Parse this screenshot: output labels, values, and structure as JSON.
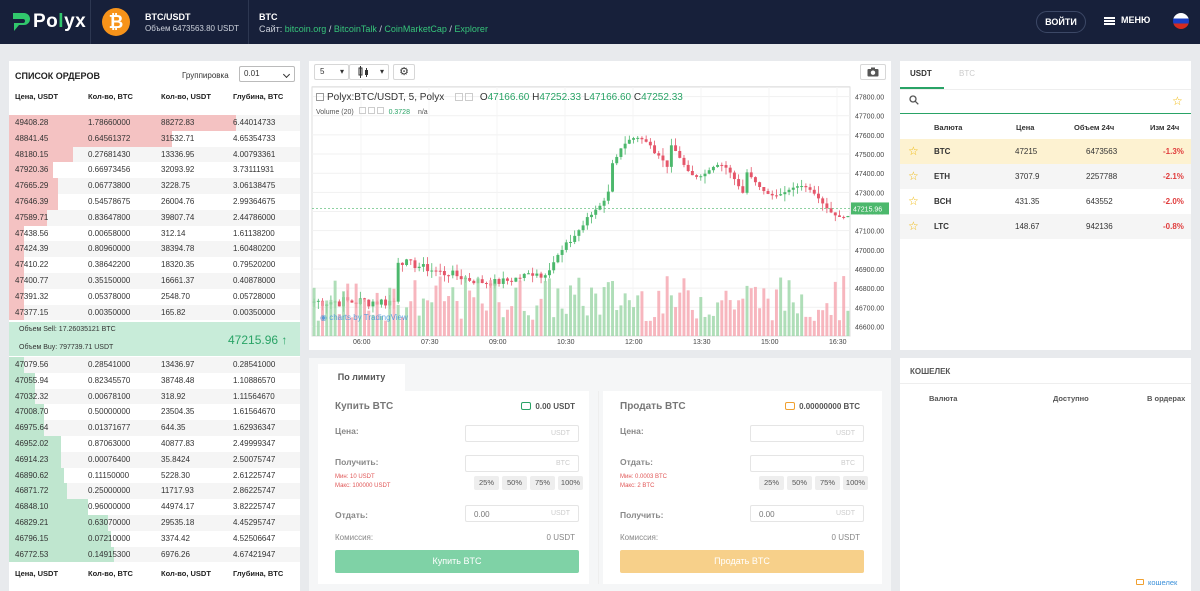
{
  "header": {
    "brand_prefix": "Po",
    "brand_mid": "l",
    "brand_suffix": "yx",
    "pair": "BTC/USDT",
    "volume": "Объем 6473563.80 USDT",
    "coin": "BTC",
    "sites_label": "Сайт:",
    "links": [
      "bitcoin.org",
      "BitcoinTalk",
      "CoinMarketCap",
      "Explorer"
    ],
    "login": "ВОЙТИ",
    "menu": "МЕНЮ"
  },
  "orderbook": {
    "title": "СПИСОК ОРДЕРОВ",
    "grouping_label": "Группировка",
    "grouping_value": "0.01",
    "headers": [
      "Цена, USDT",
      "Кол-во, BTC",
      "Кол-во, USDT",
      "Глубина, BTC"
    ],
    "asks": [
      [
        "49408.28",
        "1.78660000",
        "88272.83",
        "6.44014733",
        0.78
      ],
      [
        "48841.45",
        "0.64561372",
        "31532.71",
        "4.65354733",
        0.56
      ],
      [
        "48180.15",
        "0.27681430",
        "13336.95",
        "4.00793361",
        0.22
      ],
      [
        "47920.36",
        "0.66973456",
        "32093.92",
        "3.73111931",
        0.15
      ],
      [
        "47665.29",
        "0.06773800",
        "3228.75",
        "3.06138475",
        0.17
      ],
      [
        "47646.39",
        "0.54578675",
        "26004.76",
        "2.99364675",
        0.17
      ],
      [
        "47589.71",
        "0.83647800",
        "39807.74",
        "2.44786000",
        0.13
      ],
      [
        "47438.56",
        "0.00658000",
        "312.14",
        "1.61138200",
        0.04
      ],
      [
        "47424.39",
        "0.80960000",
        "38394.78",
        "1.60480200",
        0.03
      ],
      [
        "47410.22",
        "0.38642200",
        "18320.35",
        "0.79520200",
        0.02
      ],
      [
        "47400.77",
        "0.35150000",
        "16661.37",
        "0.40878000",
        0.02
      ],
      [
        "47391.32",
        "0.05378000",
        "2548.70",
        "0.05728000",
        0.0
      ],
      [
        "47377.15",
        "0.00350000",
        "165.82",
        "0.00350000",
        0.0
      ]
    ],
    "mid": {
      "sell": "Объем Sell: 17.26035121 BTC",
      "buy": "Объем Buy: 797739.71 USDT",
      "price": "47215.96",
      "arrow": "↑"
    },
    "bids": [
      [
        "47079.56",
        "0.28541000",
        "13436.97",
        "0.28541000",
        0.02
      ],
      [
        "47055.94",
        "0.82345570",
        "38748.48",
        "1.10886570",
        0.09
      ],
      [
        "47032.32",
        "0.00678100",
        "318.92",
        "1.11564670",
        0.09
      ],
      [
        "47008.70",
        "0.50000000",
        "23504.35",
        "1.61564670",
        0.12
      ],
      [
        "46975.64",
        "0.01371677",
        "644.35",
        "1.62936347",
        0.12
      ],
      [
        "46952.02",
        "0.87063000",
        "40877.83",
        "2.49999347",
        0.18
      ],
      [
        "46914.23",
        "0.00076400",
        "35.8424",
        "2.50075747",
        0.18
      ],
      [
        "46890.62",
        "0.11150000",
        "5228.30",
        "2.61225747",
        0.19
      ],
      [
        "46871.72",
        "0.25000000",
        "11717.93",
        "2.86225747",
        0.2
      ],
      [
        "46848.10",
        "0.96000000",
        "44974.17",
        "3.82225747",
        0.27
      ],
      [
        "46829.21",
        "0.63070000",
        "29535.18",
        "4.45295747",
        0.34
      ],
      [
        "46796.15",
        "0.07210000",
        "3374.42",
        "4.52506647",
        0.35
      ],
      [
        "46772.53",
        "0.14915300",
        "6976.26",
        "4.67421947",
        0.36
      ]
    ]
  },
  "chart_toolbar": {
    "interval": "5",
    "arrow": "▾"
  },
  "chart_data": {
    "type": "candlestick",
    "title": "Polyx:BTC/USDT, 5, Polyx",
    "ohlc_labels": {
      "o": "47166.60",
      "h": "47252.33",
      "l": "47166.60",
      "c": "47252.33"
    },
    "volume_label": "Volume (20)",
    "volume_value": "0.3728",
    "volume_na": "n/a",
    "y_ticks": [
      "47800.00",
      "47700.00",
      "47600.00",
      "47500.00",
      "47400.00",
      "47300.00",
      "47200.00",
      "47100.00",
      "47000.00",
      "46900.00",
      "46800.00",
      "46700.00",
      "46600.00"
    ],
    "x_ticks": [
      "06:00",
      "07:30",
      "09:00",
      "10:30",
      "12:00",
      "13:30",
      "15:00",
      "16:30"
    ],
    "last_price": "47215.96",
    "ylim": [
      46550,
      47850
    ],
    "watermark": "charts by TradingView"
  },
  "trade": {
    "tab": "По лимиту",
    "buy": {
      "title": "Купить BTC",
      "balance": "0.00 USDT",
      "price_label": "Цена:",
      "price_unit": "USDT",
      "receive_label": "Получить:",
      "receive_unit": "BTC",
      "min": "Мин: 10 USDT",
      "max": "Макс: 100000 USDT",
      "give_label": "Отдать:",
      "give_value": "0.00",
      "give_unit": "USDT",
      "fee_label": "Комиссия:",
      "fee_value": "0 USDT",
      "button": "Купить BTC",
      "pcts": [
        "25%",
        "50%",
        "75%",
        "100%"
      ],
      "color": "#7fd2a6"
    },
    "sell": {
      "title": "Продать BTC",
      "balance": "0.00000000 BTC",
      "price_label": "Цена:",
      "price_unit": "USDT",
      "receive_label": "Отдать:",
      "receive_unit": "BTC",
      "min": "Мин: 0.0003 BTC",
      "max": "Макс: 2 BTC",
      "give_label": "Получить:",
      "give_value": "0.00",
      "give_unit": "USDT",
      "fee_label": "Комиссия:",
      "fee_value": "0 USDT",
      "button": "Продать BTC",
      "pcts": [
        "25%",
        "50%",
        "75%",
        "100%"
      ],
      "color": "#f7d08a"
    }
  },
  "market": {
    "tab_active": "USDT",
    "tab_inactive": "BTC",
    "headers": [
      "Валюта",
      "Цена",
      "Объем 24ч",
      "Изм 24ч"
    ],
    "rows": [
      {
        "coin": "BTC",
        "price": "47215",
        "vol": "6473563",
        "chg": "-1.3%"
      },
      {
        "coin": "ETH",
        "price": "3707.9",
        "vol": "2257788",
        "chg": "-2.1%"
      },
      {
        "coin": "BCH",
        "price": "431.35",
        "vol": "643552",
        "chg": "-2.0%"
      },
      {
        "coin": "LTC",
        "price": "148.67",
        "vol": "942136",
        "chg": "-0.8%"
      }
    ]
  },
  "wallet": {
    "title": "КОШЕЛЕК",
    "headers": [
      "Валюта",
      "Доступно",
      "В ордерах"
    ],
    "link": "кошелек"
  }
}
